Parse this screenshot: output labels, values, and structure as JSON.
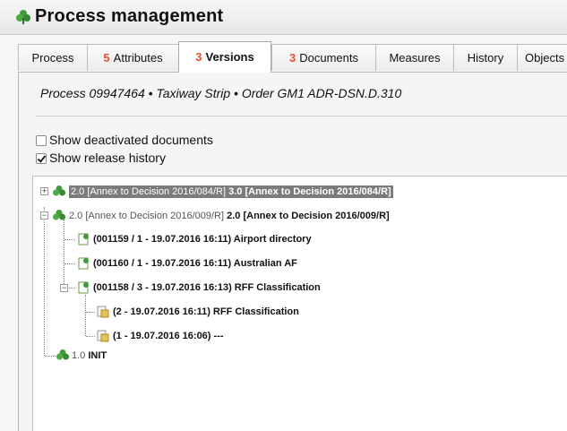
{
  "window": {
    "title": "Process management",
    "icon": "clover-icon"
  },
  "tabs": [
    {
      "num": "",
      "label": "Process"
    },
    {
      "num": "5",
      "label": "Attributes"
    },
    {
      "num": "3",
      "label": "Versions"
    },
    {
      "num": "3",
      "label": "Documents"
    },
    {
      "num": "",
      "label": "Measures"
    },
    {
      "num": "",
      "label": "History"
    },
    {
      "num": "",
      "label": "Objects"
    }
  ],
  "subtitle": "Process 09947464 • Taxiway Strip • Order GM1 ADR-DSN.D.310",
  "options": {
    "show_deactivated": {
      "label": "Show deactivated documents",
      "checked": false
    },
    "show_release_history": {
      "label": "Show release history",
      "checked": true
    }
  },
  "tree": {
    "v30": {
      "light": "2.0 [Annex to Decision 2016/084/R]",
      "bold": "3.0 [Annex to Decision 2016/084/R]"
    },
    "v20": {
      "light": "2.0 [Annex to Decision 2016/009/R]",
      "bold": "2.0 [Annex to Decision 2016/009/R]"
    },
    "doc1": "(001159 / 1 - 19.07.2016 16:11) Airport directory",
    "doc2": "(001160 / 1 - 19.07.2016 16:11) Australian AF",
    "doc3": "(001158 / 3 - 19.07.2016 16:13) RFF Classification",
    "sub1": "(2 - 19.07.2016 16:11) RFF Classification",
    "sub2": "(1 - 19.07.2016 16:06) ---",
    "v10": {
      "light": "1.0",
      "bold": "INIT"
    }
  },
  "colors": {
    "accent_number": "#e8502d",
    "selection": "#7b7b7b",
    "clover": "#3f9b3c"
  }
}
